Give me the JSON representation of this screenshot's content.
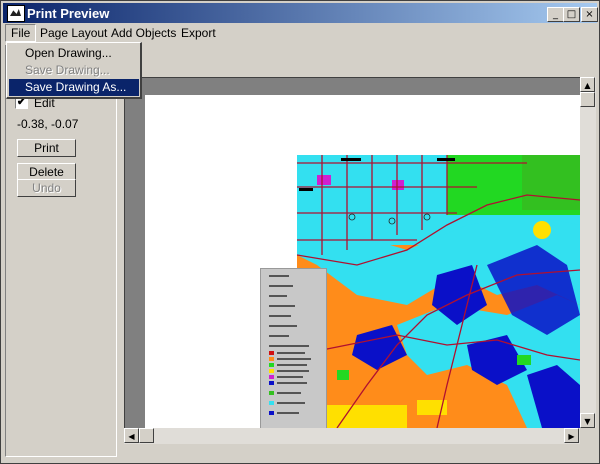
{
  "window": {
    "title": "Print Preview",
    "controls": [
      "_",
      "□",
      "×"
    ]
  },
  "menubar": {
    "items": [
      "File",
      "Page Layout",
      "Add Objects",
      "Export"
    ],
    "active": "File"
  },
  "file_menu": {
    "items": [
      {
        "label": "Open Drawing...",
        "state": "enabled"
      },
      {
        "label": "Save Drawing...",
        "state": "disabled"
      },
      {
        "label": "Save Drawing As...",
        "state": "highlighted"
      }
    ]
  },
  "left_panel": {
    "edit_label": "Edit",
    "edit_checked": true,
    "checkmark": "✔",
    "coordinates": "-0.38, -0.07",
    "print_label": "Print",
    "delete_label": "Delete",
    "undo_label": "Undo"
  },
  "scroll": {
    "up": "▲",
    "down": "▼",
    "left": "◀",
    "right": "▶"
  },
  "colors": {
    "title_start": "#0a246a",
    "title_end": "#a6caf0",
    "highlight": "#0a246a",
    "map_orange": "#ff8c1a",
    "map_cyan": "#33e0f0",
    "map_blue": "#0a10c8",
    "map_green": "#22d822",
    "road_red": "#b01030"
  }
}
